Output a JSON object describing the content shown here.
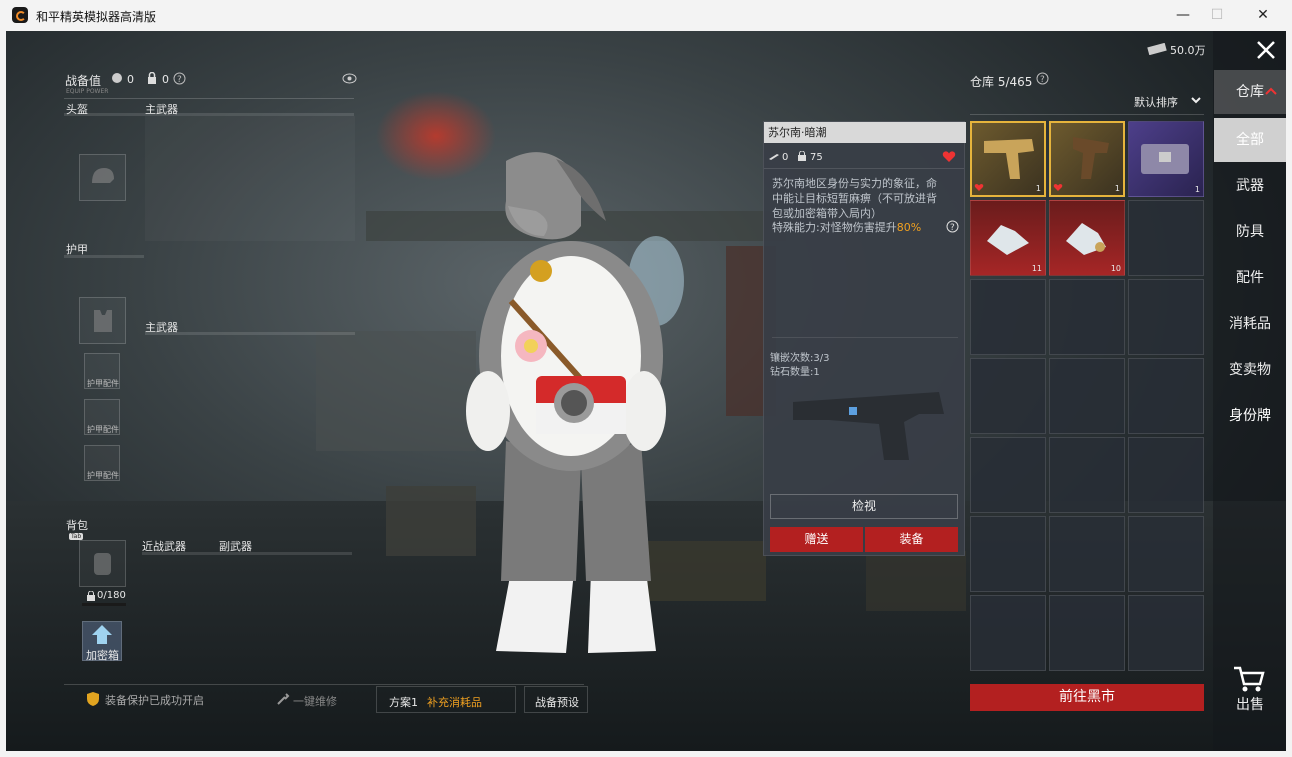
{
  "window": {
    "title": "和平精英模拟器高清版",
    "minimize_glyph": "—",
    "maximize_glyph": "☐",
    "close_glyph": "✕"
  },
  "currency": {
    "amount": "50.0万"
  },
  "loadout": {
    "combat_label": "战备值",
    "combat_value_1": "0",
    "combat_value_2": "0",
    "combat_sub": "EQUIP POWER",
    "helmet_label": "头盔",
    "primary_weapon_label": "主武器",
    "armor_label": "护甲",
    "primary_weapon_label_2": "主武器",
    "armor_parts": [
      "护甲配件",
      "护甲配件",
      "护甲配件"
    ],
    "backpack_label": "背包",
    "backpack_hint": "Tab",
    "backpack_capacity": "0/180",
    "melee_label": "近战武器",
    "secondary_label": "副武器",
    "safebox_label": "加密箱"
  },
  "bottom_bar": {
    "protect_text": "装备保护已成功开启",
    "repair_text": "一键维修",
    "plan_label": "方案1",
    "plan_action": "补充消耗品",
    "preset_label": "战备预设"
  },
  "item_detail": {
    "name": "苏尔南·暗潮",
    "stat_a": "0",
    "stat_b": "75",
    "description": "苏尔南地区身份与实力的象征，命中能让目标短暂麻痹（不可放进背包或加密箱带入局内）",
    "ability_prefix": "特殊能力:对怪物伤害提升",
    "ability_value": "80%",
    "inlay_count": "镶嵌次数:3/3",
    "diamond_count": "钻石数量:1",
    "inspect_label": "检视",
    "gift_label": "赠送",
    "equip_label": "装备"
  },
  "inventory": {
    "title": "仓库 5/465",
    "sort_label": "默认排序",
    "items": [
      {
        "count": "1",
        "fav": true
      },
      {
        "count": "1",
        "fav": true
      },
      {
        "count": "1",
        "fav": false
      },
      {
        "count": "11",
        "fav": false
      },
      {
        "count": "10",
        "fav": false
      }
    ],
    "black_market_label": "前往黑市"
  },
  "tabs": {
    "warehouse": "仓库",
    "all": "全部",
    "weapons": "武器",
    "armor": "防具",
    "parts": "配件",
    "consumables": "消耗品",
    "valuables": "变卖物",
    "id_tags": "身份牌",
    "sell": "出售"
  }
}
